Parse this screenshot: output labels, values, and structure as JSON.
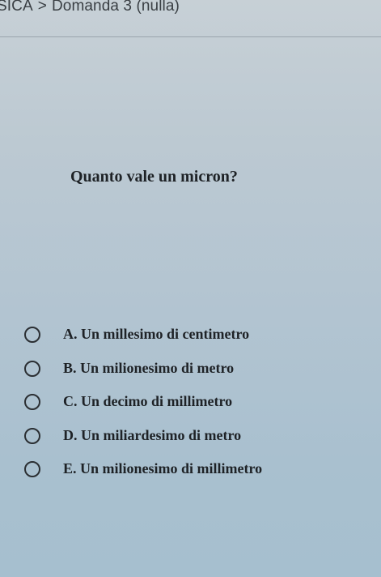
{
  "breadcrumb": {
    "section": "SICA",
    "separator": ">",
    "current": "Domanda 3 (nulla)"
  },
  "question": {
    "text": "Quanto vale un micron?"
  },
  "answers": [
    {
      "label": "A. Un millesimo di centimetro"
    },
    {
      "label": "B. Un milionesimo di metro"
    },
    {
      "label": "C. Un decimo di millimetro"
    },
    {
      "label": "D. Un miliardesimo di metro"
    },
    {
      "label": "E. Un milionesimo di millimetro"
    }
  ]
}
